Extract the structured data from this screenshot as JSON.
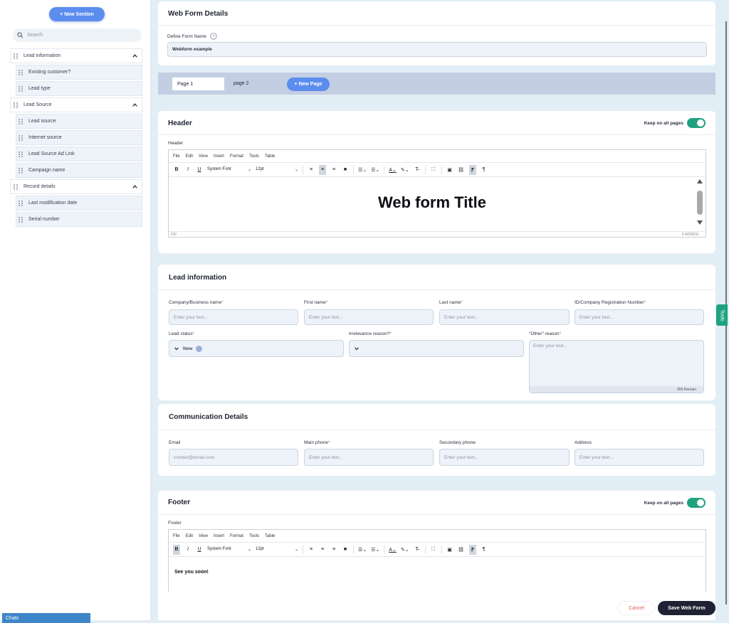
{
  "sidebar": {
    "new_section_label": "+ New Section",
    "search_placeholder": "Search",
    "groups": [
      {
        "label": "Lead information",
        "items": [
          "Existing customer?",
          "Lead type"
        ]
      },
      {
        "label": "Lead Source",
        "items": [
          "Lead source",
          "Internet source",
          "Lead Source Ad Link",
          "Campaign name"
        ]
      },
      {
        "label": "Record details",
        "items": [
          "Last modification date",
          "Serial number"
        ]
      }
    ]
  },
  "chats_label": "Chats",
  "tools_label": "Tools",
  "details": {
    "title": "Web Form Details",
    "form_name_label": "Define Form Name",
    "form_name_value": "Webform example"
  },
  "pages": {
    "tabs": [
      "Page 1",
      "page 2"
    ],
    "new_page_label": "+ New Page"
  },
  "header_section": {
    "title": "Header",
    "keep_label": "Keep on all pages",
    "editor_label": "Header",
    "content": "Web form Title",
    "status_path": "DIV",
    "word_count": "3 WORDS"
  },
  "editor_menu": [
    "File",
    "Edit",
    "View",
    "Insert",
    "Format",
    "Tools",
    "Table"
  ],
  "editor_toolbar": {
    "font": "System Font",
    "size": "12pt",
    "bold": "B",
    "italic": "I",
    "underline": "U"
  },
  "lead_info": {
    "title": "Lead information",
    "fields": [
      {
        "label": "Company/Business name",
        "required": "*",
        "placeholder": "Enter your text..."
      },
      {
        "label": "First name",
        "required": "*",
        "placeholder": "Enter your text..."
      },
      {
        "label": "Last name",
        "required": "*",
        "placeholder": "Enter your text..."
      },
      {
        "label": "ID/Company Registration Number",
        "required": "*",
        "placeholder": "Enter your text..."
      }
    ],
    "lead_status_label": "Lead status",
    "lead_status_value": "New",
    "irrelevance_label": "Irrelevance reason?",
    "other_reason_label": "\"Other\" reason",
    "other_reason_placeholder": "Enter your text...",
    "remain_text": "999 Remain"
  },
  "communication": {
    "title": "Communication Details",
    "fields": [
      {
        "label": "Email",
        "required": "",
        "placeholder": "contact@email.com"
      },
      {
        "label": "Main phone",
        "required": "*",
        "placeholder": "Enter your text..."
      },
      {
        "label": "Secondary phone",
        "required": "",
        "placeholder": "Enter your text..."
      },
      {
        "label": "Address",
        "required": "",
        "placeholder": "Enter your text..."
      }
    ]
  },
  "footer_section": {
    "title": "Footer",
    "keep_label": "Keep on all pages",
    "editor_label": "Footer",
    "content": "See you soon!"
  },
  "actions": {
    "cancel_label": "Cancel",
    "save_label": "Save Web Form"
  },
  "colors": {
    "accent": "#5b8def",
    "toggle": "#1fa27f",
    "required": "#e0584f",
    "save": "#1e2233"
  }
}
